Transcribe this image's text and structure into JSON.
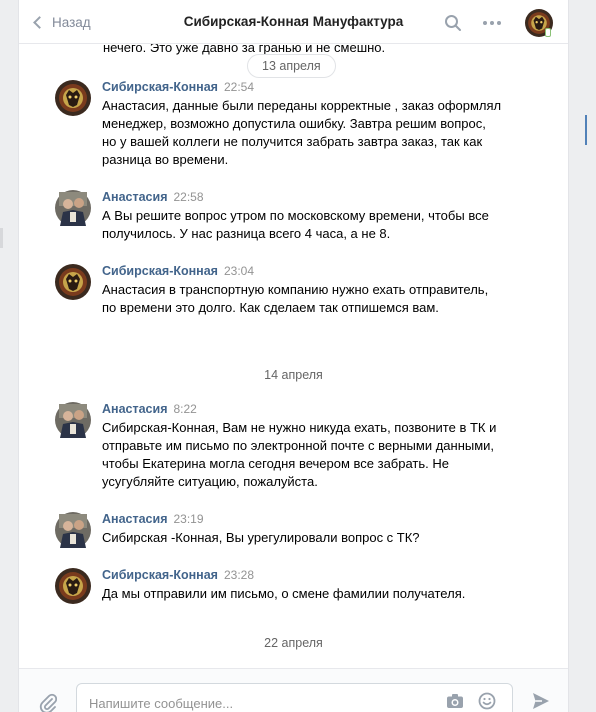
{
  "header": {
    "back_label": "Назад",
    "title": "Сибирская-Конная Мануфактура"
  },
  "partial_top_text": "нечего. Это уже давно за гранью и не смешно.",
  "dates": {
    "d1": "13 апреля",
    "d2": "14 апреля",
    "d3": "22 апреля"
  },
  "messages": [
    {
      "name": "Сибирская-Конная",
      "time": "22:54",
      "text": "Анастасия, данные были переданы корректные , заказ оформлял менеджер, возможно допустила ошибку. Завтра решим вопрос, но у вашей коллеги не получится забрать завтра заказ, так как разница во времени."
    },
    {
      "name": "Анастасия",
      "time": "22:58",
      "text": "А Вы решите вопрос утром по московскому времени, чтобы все получилось. У нас разница всего 4 часа, а не 8."
    },
    {
      "name": "Сибирская-Конная",
      "time": "23:04",
      "text": "Анастасия в транспортную компанию нужно ехать отправитель, по времени это долго. Как сделаем так отпишемся вам."
    },
    {
      "name": "Анастасия",
      "time": "8:22",
      "text": "Сибирская-Конная, Вам не нужно никуда ехать, позвоните в ТК и отправьте им письмо по электронной почте с верными данными, чтобы Екатерина могла сегодня вечером все забрать. Не усугубляйте ситуацию, пожалуйста."
    },
    {
      "name": "Анастасия",
      "time": "23:19",
      "text": "Сибирская -Конная, Вы урегулировали вопрос с ТК?"
    },
    {
      "name": "Сибирская-Конная",
      "time": "23:28",
      "text": "Да мы отправили им письмо, о смене фамилии получателя."
    }
  ],
  "composer": {
    "placeholder": "Напишите сообщение..."
  },
  "colors": {
    "link": "#42648b",
    "muted": "#939393",
    "border": "#e7e8ec"
  }
}
